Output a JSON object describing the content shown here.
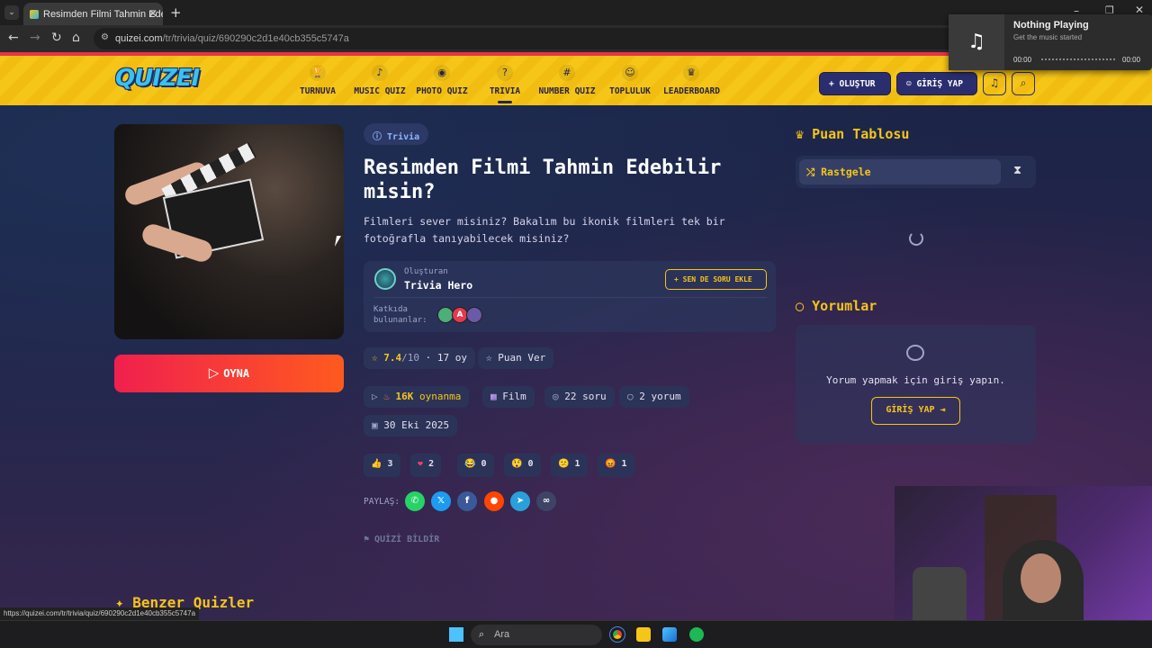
{
  "browser": {
    "tab_title": "Resimden Filmi Tahmin Edebilir",
    "url_host": "quizei.com",
    "url_path": "/tr/trivia/quiz/690290c2d1e40cb355c5747a",
    "status_url": "https://quizei.com/tr/trivia/quiz/690290c2d1e40cb355c5747a"
  },
  "media": {
    "title": "Nothing Playing",
    "subtitle": "Get the music started",
    "time_start": "00:00",
    "time_end": "00:00"
  },
  "header": {
    "logo": "QUIZEI",
    "nav": [
      {
        "label": "TURNUVA",
        "icon": "trophy-icon",
        "glyph": "🏆"
      },
      {
        "label": "MUSIC QUIZ",
        "icon": "music-note-icon",
        "glyph": "♪"
      },
      {
        "label": "PHOTO QUIZ",
        "icon": "camera-icon",
        "glyph": "◉"
      },
      {
        "label": "TRIVIA",
        "icon": "question-icon",
        "glyph": "?"
      },
      {
        "label": "NUMBER QUIZ",
        "icon": "hash-icon",
        "glyph": "#"
      },
      {
        "label": "TOPLULUK",
        "icon": "users-icon",
        "glyph": "☺"
      },
      {
        "label": "LEADERBOARD",
        "icon": "medal-icon",
        "glyph": "♛"
      }
    ],
    "create_label": "OLUŞTUR",
    "login_label": "GİRİŞ YAP"
  },
  "quiz": {
    "category": "Trivia",
    "title": "Resimden Filmi Tahmin Edebilir misin?",
    "description": "Filmleri sever misiniz? Bakalım bu ikonik filmleri tek bir fotoğrafla tanıyabilecek misiniz?",
    "play_label": "OYNA",
    "creator_caption": "Oluşturan",
    "creator_name": "Trivia Hero",
    "add_question_label": "SEN DE SORU EKLE",
    "contributors_label": "Katkıda bulunanlar:",
    "rating": "7.4",
    "rating_max": "/10",
    "votes": "· 17 oy",
    "rate_label": "Puan Ver",
    "plays_count": "16K",
    "plays_label": "oynanma",
    "genre": "Film",
    "questions": "22 soru",
    "comments_count": "2 yorum",
    "date": "30 Eki 2025",
    "reactions": [
      {
        "emoji": "👍",
        "count": "3"
      },
      {
        "emoji": "❤",
        "count": "2"
      },
      {
        "emoji": "😂",
        "count": "0"
      },
      {
        "emoji": "😲",
        "count": "0"
      },
      {
        "emoji": "😕",
        "count": "1"
      },
      {
        "emoji": "😡",
        "count": "1"
      }
    ],
    "share_label": "PAYLAŞ:",
    "report_label": "QUİZİ BİLDİR"
  },
  "sidebar": {
    "leaderboard_title": "Puan Tablosu",
    "leaderboard_filter": "Rastgele",
    "comments_title": "Yorumlar",
    "comments_prompt": "Yorum yapmak için giriş yapın.",
    "comments_login": "GİRİŞ YAP"
  },
  "similar_title": "Benzer Quizler",
  "taskbar": {
    "search_placeholder": "Ara"
  },
  "colors": {
    "accent": "#f5c518",
    "header_bg": "#f5c518",
    "play_start": "#f0204e",
    "play_end": "#ff5a1f",
    "navy": "#2b2e6e"
  }
}
